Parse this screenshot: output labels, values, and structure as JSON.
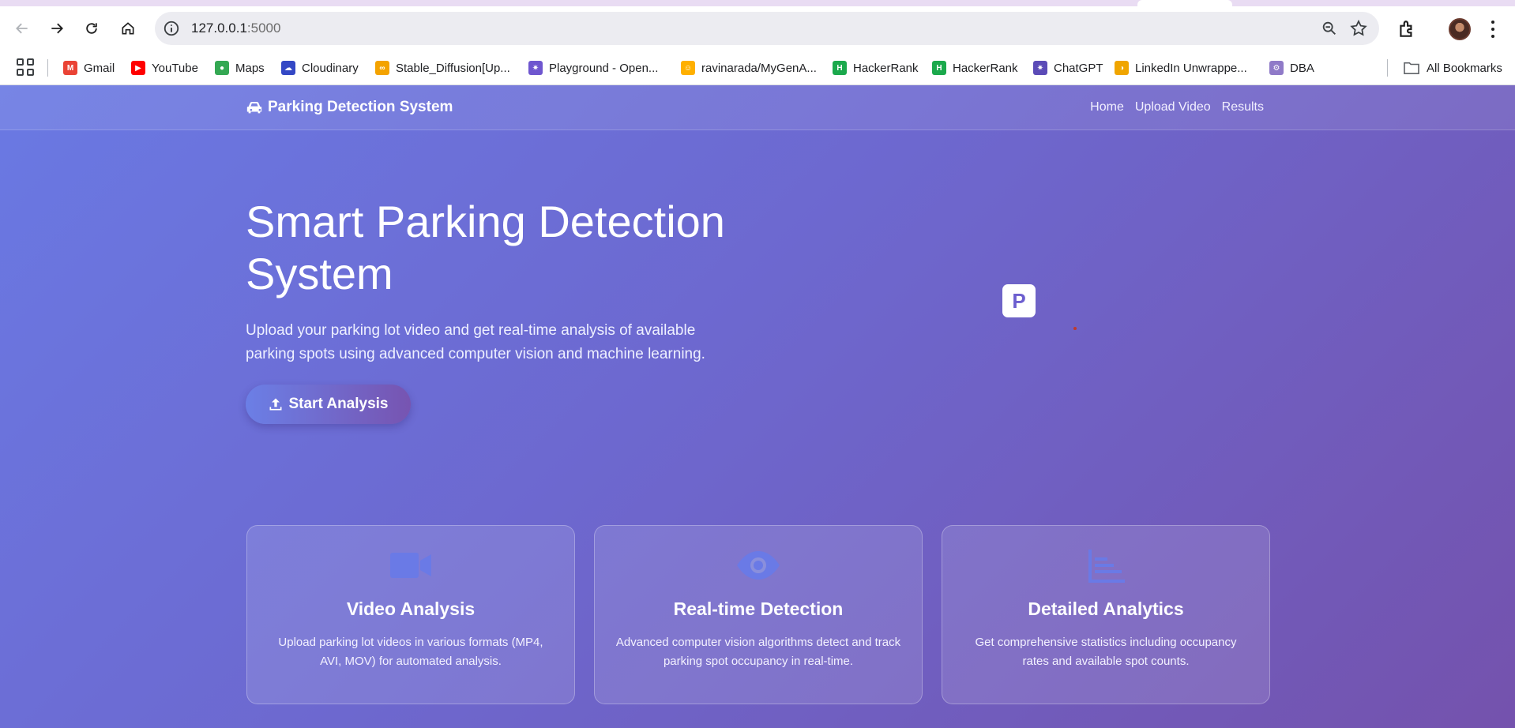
{
  "browser": {
    "url_host": "127.0.0.1",
    "url_port": ":5000",
    "bookmarks": [
      {
        "label": "Gmail",
        "icon": "gmail-icon",
        "color": "#ea4335"
      },
      {
        "label": "YouTube",
        "icon": "youtube-icon",
        "color": "#ff0000"
      },
      {
        "label": "Maps",
        "icon": "maps-icon",
        "color": "#34a853"
      },
      {
        "label": "Cloudinary",
        "icon": "cloudinary-icon",
        "color": "#3448c5"
      },
      {
        "label": "Stable_Diffusion[Up...",
        "icon": "link-icon",
        "color": "#f4a300"
      },
      {
        "label": "Playground - Open...",
        "icon": "openai-icon",
        "color": "#6e56cf"
      },
      {
        "label": "ravinarada/MyGenA...",
        "icon": "huggingface-icon",
        "color": "#ffb000"
      },
      {
        "label": "HackerRank",
        "icon": "hackerrank-icon",
        "color": "#1ba94c"
      },
      {
        "label": "HackerRank",
        "icon": "hackerrank-icon",
        "color": "#1ba94c"
      },
      {
        "label": "ChatGPT",
        "icon": "chatgpt-icon",
        "color": "#5b4bb7"
      },
      {
        "label": "LinkedIn Unwrappe...",
        "icon": "linkedin-icon",
        "color": "#f0a500"
      },
      {
        "label": "DBA",
        "icon": "dba-icon",
        "color": "#8f7ac8"
      }
    ],
    "all_bookmarks": "All Bookmarks"
  },
  "site": {
    "brand": "Parking Detection System",
    "nav": [
      "Home",
      "Upload Video",
      "Results"
    ]
  },
  "hero": {
    "title": "Smart Parking Detection System",
    "subtitle": "Upload your parking lot video and get real-time analysis of available parking spots using advanced computer vision and machine learning.",
    "cta": "Start Analysis",
    "sign_letter": "P"
  },
  "features": [
    {
      "icon": "video-camera-icon",
      "title": "Video Analysis",
      "text": "Upload parking lot videos in various formats (MP4, AVI, MOV) for automated analysis."
    },
    {
      "icon": "eye-icon",
      "title": "Real-time Detection",
      "text": "Advanced computer vision algorithms detect and track parking spot occupancy in real-time."
    },
    {
      "icon": "chart-bars-icon",
      "title": "Detailed Analytics",
      "text": "Get comprehensive statistics including occupancy rates and available spot counts."
    }
  ],
  "colors": {
    "gradient_start": "#6a79e3",
    "gradient_end": "#7452ad",
    "feature_icon": "#6a7ae6"
  }
}
